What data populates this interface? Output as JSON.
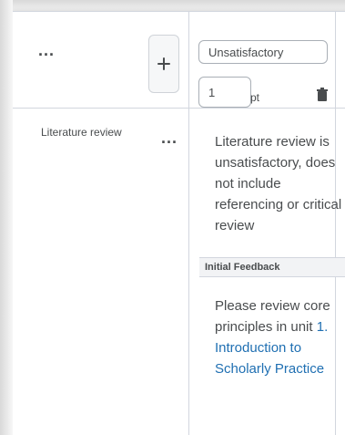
{
  "header": {
    "criteria_menu_label": "...",
    "add_criterion_label": "+",
    "level_name_value": "Unsatisfactory",
    "points_value": "1",
    "points_unit": "pt"
  },
  "criterion": {
    "name": "Literature review",
    "menu_label": "..."
  },
  "cell": {
    "description": "Literature review is unsatisfactory, does not include referencing or critical review",
    "feedback_header": "Initial Feedback",
    "feedback_prefix": "Please review core principles in unit ",
    "feedback_link_1": "1.",
    "feedback_link_2": "Introduction to Scholarly Practice"
  },
  "colors": {
    "text": "#494c4e",
    "link": "#1f6fb2",
    "border": "#d2d6de"
  },
  "icons": {
    "add": "plus-icon",
    "delete": "trash-icon"
  }
}
